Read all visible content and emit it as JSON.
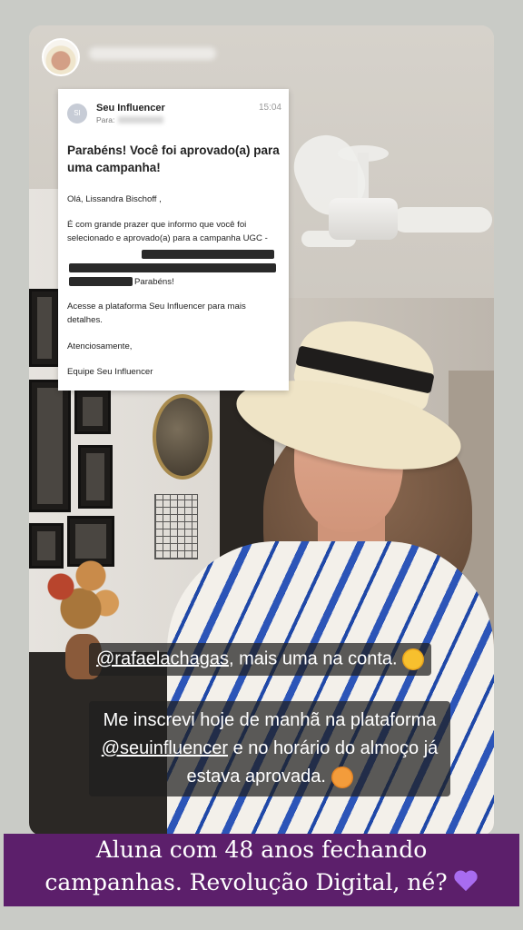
{
  "email": {
    "sender_initials": "SI",
    "sender": "Seu Influencer",
    "time": "15:04",
    "to_label": "Para:",
    "subject": "Parabéns! Você foi aprovado(a) para uma campanha!",
    "greeting": "Olá, Lissandra Bischoff ,",
    "body1": "É com grande prazer que informo que você foi selecionado e aprovado(a) para a campanha UGC -",
    "body1_end": "Parabéns!",
    "body2": "Acesse a plataforma Seu Influencer para mais detalhes.",
    "closing": "Atenciosamente,",
    "signature": "Equipe Seu Influencer"
  },
  "captions": {
    "line1_mention": "@rafaelachagas",
    "line1_text": ", mais uma na conta.",
    "line1_emoji": "winking-face",
    "line2a": "Me inscrevi hoje de manhã na plataforma",
    "line2_mention": "@seuinfluencer",
    "line2b": " e no horário do almoço já",
    "line2c": "estava aprovada.",
    "line2_emoji": "face-blowing-kiss"
  },
  "banner": {
    "line1": "Aluna com 48 anos fechando",
    "line2": "campanhas. Revolução Digital, né?",
    "emoji": "purple-heart"
  }
}
